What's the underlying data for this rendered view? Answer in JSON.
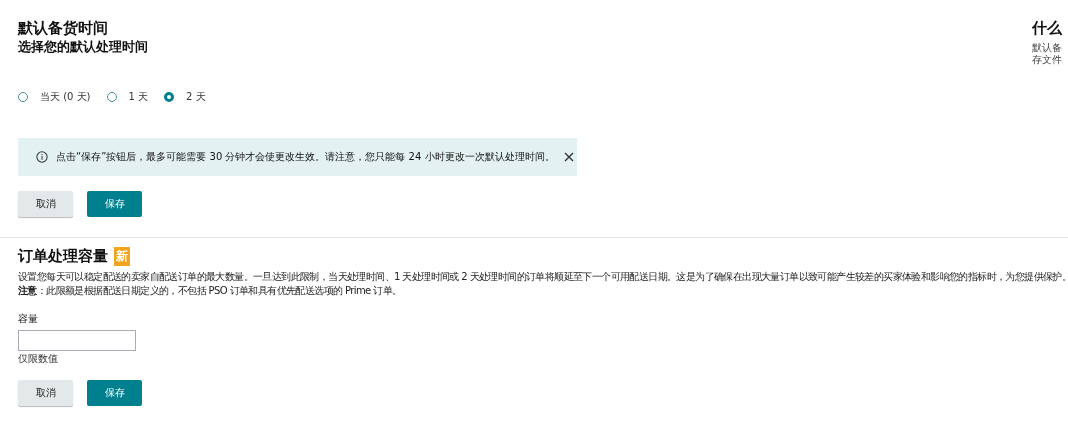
{
  "handling_time": {
    "title": "默认备货时间",
    "subtitle": "选择您的默认处理时间",
    "options": [
      {
        "label": "当天 (0 天)",
        "selected": false
      },
      {
        "label": "1 天",
        "selected": false
      },
      {
        "label": "2 天",
        "selected": true
      }
    ],
    "notice": {
      "text": "点击“保存”按钮后，最多可能需要 30 分钟才会使更改生效。请注意，您只能每 24 小时更改一次默认处理时间。"
    },
    "buttons": [
      {
        "label": "取消",
        "kind": "secondary"
      },
      {
        "label": "保存",
        "kind": "primary"
      }
    ]
  },
  "side_panel": {
    "title": "什么",
    "lines": [
      "默认备",
      "存文件"
    ]
  },
  "capacity": {
    "title": "订单处理容量",
    "badge": "新",
    "description": "设置您每天可以稳定配送的卖家自配送订单的最大数量。一旦达到此限制，当天处理时间、1 天处理时间或 2 天处理时间的订单将顺延至下一个可用配送日期。这是为了确保在出现大量订单以致可能产生较差的买家体验和影响您的指标时，为您提供保护。",
    "note": "**注意**：此限额是根据配送日期定义的，不包括 PSO 订单和具有优先配送选项的 Prime 订单。",
    "field_label": "容量",
    "field_hint": "仅限数值",
    "buttons": [
      {
        "label": "取消",
        "kind": "secondary"
      },
      {
        "label": "保存",
        "kind": "primary"
      }
    ]
  }
}
